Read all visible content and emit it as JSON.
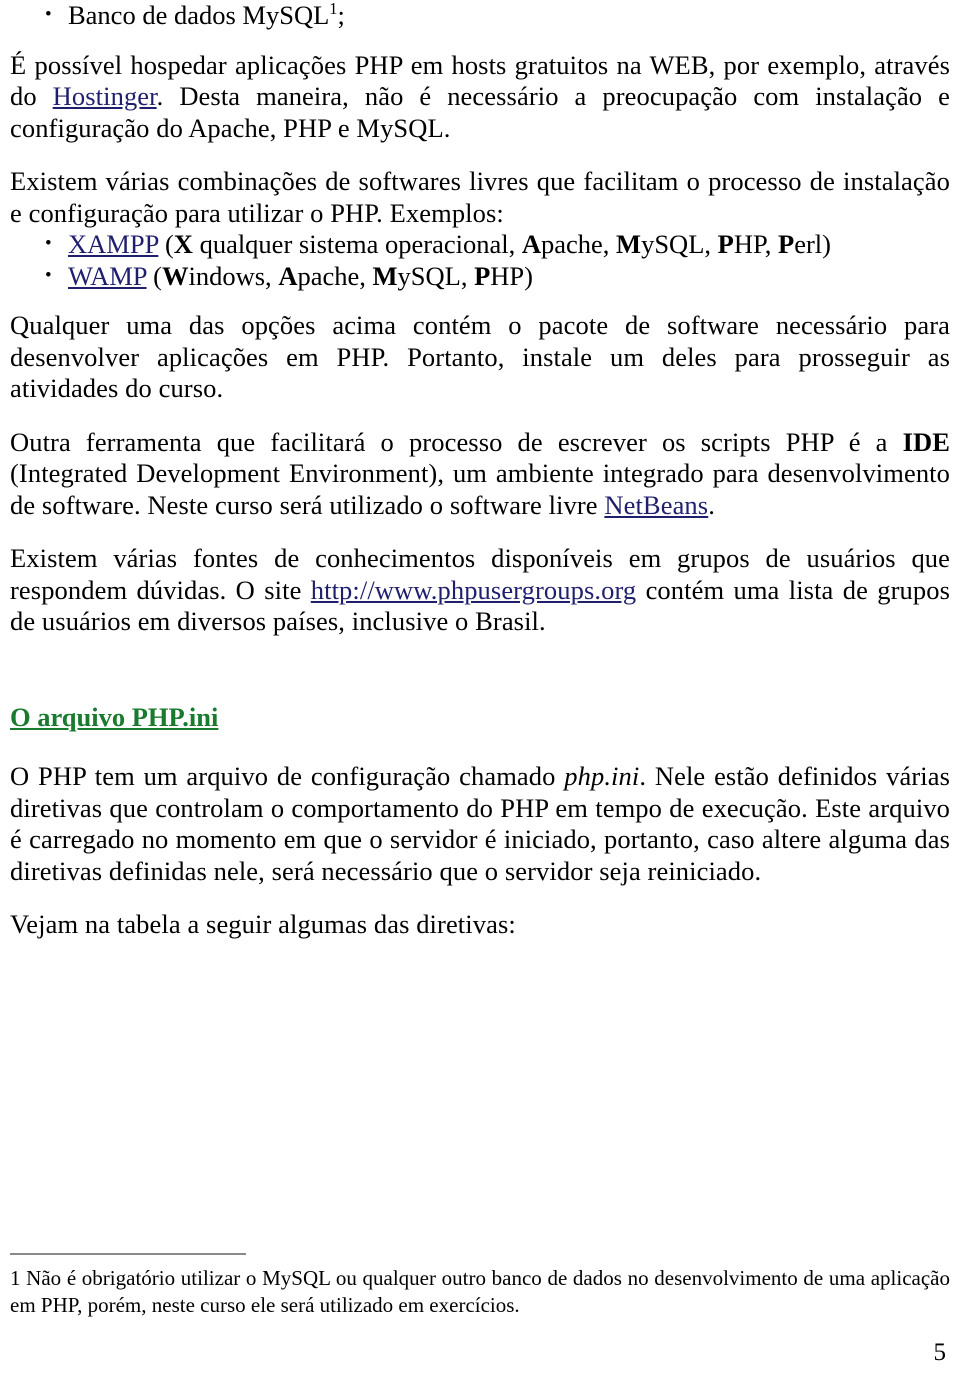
{
  "document": {
    "page_number": "5",
    "link_color": "#1f1f6e",
    "heading_color": "#1a7a2e",
    "blocks": {
      "bullet_mysql": {
        "text_before": "Banco de dados MySQL",
        "superscript": "1",
        "text_after": ";"
      },
      "para_hosting": {
        "part1": "É possível hospedar aplicações PHP em hosts gratuitos na WEB, por exemplo, através do ",
        "link": "Hostinger",
        "part2": ". Desta maneira, não é necessário a preocupação com instalação e configuração do Apache, PHP e MySQL."
      },
      "para_combinacoes": {
        "text": "Existem várias combinações de softwares livres que facilitam o processo de instalação e configuração para utilizar o PHP. Exemplos:"
      },
      "bullet_xampp": {
        "link": "XAMPP",
        "open": " (",
        "b1": "X",
        "t1": " qualquer sistema operacional, ",
        "b2": "A",
        "t2": "pache, ",
        "b3": "M",
        "t3": "ySQL, ",
        "b4": "P",
        "t4": "HP, ",
        "b5": "P",
        "t5": "erl)"
      },
      "bullet_wamp": {
        "link": "WAMP",
        "open": " (",
        "b1": "W",
        "t1": "indows, ",
        "b2": "A",
        "t2": "pache, ",
        "b3": "M",
        "t3": "ySQL, ",
        "b4": "P",
        "t4": "HP)"
      },
      "para_qualquer": {
        "text": "Qualquer uma das opções acima contém o pacote de software necessário para desenvolver aplicações em PHP. Portanto, instale um deles para prosseguir as atividades do curso."
      },
      "para_ide": {
        "part1": "Outra ferramenta que facilitará o processo de escrever os scripts PHP é a ",
        "bold": "IDE",
        "part2": " (Integrated Development Environment), um ambiente integrado para desenvolvimento de software. Neste curso será utilizado o software livre ",
        "link": "NetBeans",
        "part3": "."
      },
      "para_fontes": {
        "part1": "Existem várias fontes de conhecimentos disponíveis em grupos de usuários que respondem dúvidas. O site ",
        "link": "http://www.phpusergroups.org",
        "part2": " contém uma lista de grupos de usuários em diversos países, inclusive o Brasil."
      },
      "heading_phpini": {
        "text": "O arquivo PHP.ini"
      },
      "para_phpini": {
        "part1": "O PHP tem um arquivo de configuração chamado ",
        "italic": "php.ini",
        "part2": ". Nele estão definidos várias diretivas que controlam o comportamento do PHP em tempo de execução. Este arquivo é carregado no momento em que o servidor é iniciado, portanto, caso altere alguma das diretivas definidas nele, será necessário que o servidor seja reiniciado."
      },
      "para_tabela": {
        "text": "Vejam na tabela a seguir algumas das diretivas:"
      },
      "footnote": {
        "marker": "1",
        "text": " Não é obrigatório utilizar o MySQL ou qualquer outro banco de dados no desenvolvimento de uma aplicação em PHP, porém, neste curso ele será utilizado em exercícios."
      }
    }
  }
}
